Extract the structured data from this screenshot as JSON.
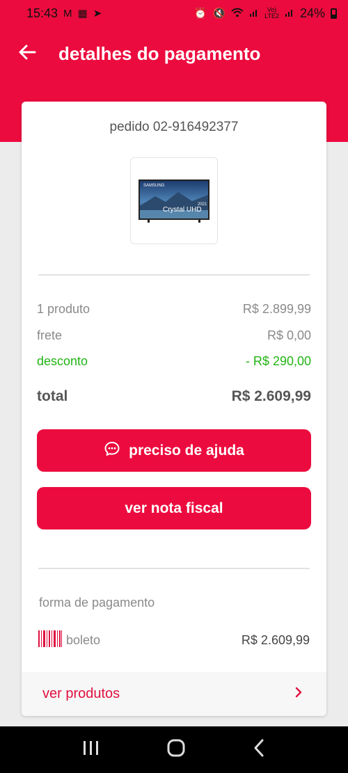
{
  "status_bar": {
    "time": "15:43",
    "battery": "24%",
    "icons": [
      "gmail-icon",
      "app-icon",
      "telegram-icon",
      "alarm-icon",
      "mute-icon",
      "wifi-icon",
      "signal-icon",
      "volte-icon",
      "signal-icon",
      "battery-icon"
    ]
  },
  "header": {
    "title": "detalhes do pagamento",
    "back_icon": "arrow-left-icon"
  },
  "order": {
    "id_text": "pedido 02-916492377",
    "product_image_brand": "SAMSUNG",
    "product_image_year": "2021",
    "product_image_model": "Crystal UHD"
  },
  "summary": {
    "products_label": "1 produto",
    "products_value": "R$ 2.899,99",
    "shipping_label": "frete",
    "shipping_value": "R$ 0,00",
    "discount_label": "desconto",
    "discount_value": "- R$ 290,00",
    "total_label": "total",
    "total_value": "R$ 2.609,99"
  },
  "actions": {
    "help_label": "preciso de ajuda",
    "invoice_label": "ver nota fiscal"
  },
  "payment": {
    "section_label": "forma de pagamento",
    "method": "boleto",
    "amount": "R$ 2.609,99"
  },
  "footer_link": {
    "label": "ver produtos"
  },
  "colors": {
    "brand_red": "#ec0b3e",
    "discount_green": "#22b414"
  }
}
